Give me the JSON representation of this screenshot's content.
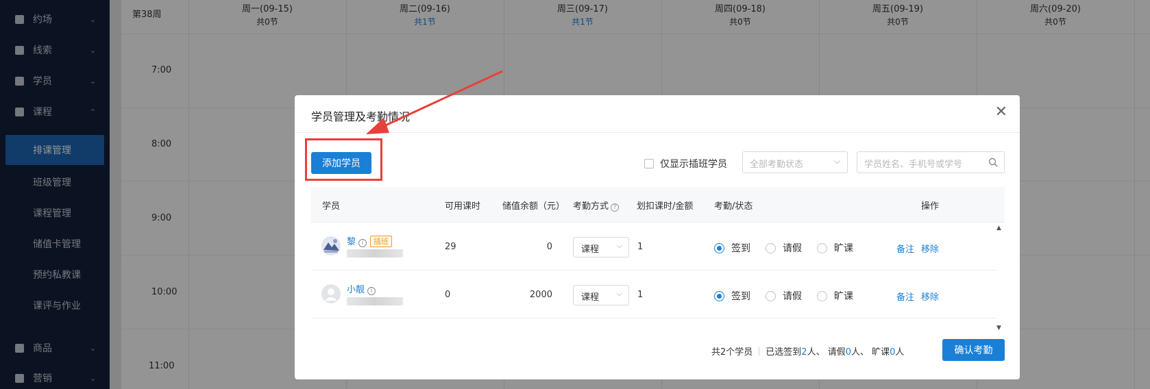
{
  "sidebar": {
    "items": [
      {
        "label": "约场",
        "icon": "calendar-check-icon",
        "expanded": false
      },
      {
        "label": "线索",
        "icon": "user-clue-icon",
        "expanded": false
      },
      {
        "label": "学员",
        "icon": "student-card-icon",
        "expanded": false
      },
      {
        "label": "课程",
        "icon": "course-book-icon",
        "expanded": true
      },
      {
        "label": "商品",
        "icon": "shopping-bag-icon",
        "expanded": false
      },
      {
        "label": "营销",
        "icon": "marketing-icon",
        "expanded": false
      }
    ],
    "course_sub": [
      "排课管理",
      "班级管理",
      "课程管理",
      "储值卡管理",
      "预约私教课",
      "课评与作业"
    ],
    "active_sub": "排课管理"
  },
  "calendar": {
    "week_label": "第38周",
    "days": [
      {
        "name": "周一(09-15)",
        "count": "共0节",
        "highlight": false
      },
      {
        "name": "周二(09-16)",
        "count": "共1节",
        "highlight": true
      },
      {
        "name": "周三(09-17)",
        "count": "共1节",
        "highlight": true
      },
      {
        "name": "周四(09-18)",
        "count": "共0节",
        "highlight": false
      },
      {
        "name": "周五(09-19)",
        "count": "共0节",
        "highlight": false
      },
      {
        "name": "周六(09-20)",
        "count": "共0节",
        "highlight": false
      }
    ],
    "times": [
      "7:00",
      "8:00",
      "9:00",
      "10:00",
      "11:00"
    ]
  },
  "modal": {
    "title": "学员管理及考勤情况",
    "add_student_label": "添加学员",
    "only_insert_label": "仅显示插班学员",
    "status_filter_placeholder": "全部考勤状态",
    "search_placeholder": "学员姓名、手机号或学号",
    "columns": {
      "student": "学员",
      "available_hours": "可用课时",
      "balance": "储值余额（元）",
      "attend_method": "考勤方式",
      "deduct": "划扣课时/金额",
      "status": "考勤/状态",
      "ops": "操作"
    },
    "rows": [
      {
        "name": "黎",
        "tag": "插班",
        "available_hours": "29",
        "balance": "0",
        "method": "课程",
        "deduct": "1",
        "status": "签到",
        "avatar": "photo-avatar"
      },
      {
        "name": "小靓",
        "tag": "",
        "available_hours": "0",
        "balance": "2000",
        "method": "课程",
        "deduct": "1",
        "status": "签到",
        "avatar": "default-avatar"
      }
    ],
    "status_options": [
      "签到",
      "请假",
      "旷课"
    ],
    "action_note": "备注",
    "action_remove": "移除",
    "footer": {
      "total": "共2个学员",
      "selected_prefix": "已选签到",
      "signed_count": "2",
      "unit1": "人、 请假",
      "leave_count": "0",
      "unit2": "人、 旷课",
      "absent_count": "0",
      "unit3": "人"
    },
    "confirm_label": "确认考勤"
  },
  "colors": {
    "primary": "#1a7fd6",
    "sidebar_bg": "#14203a",
    "highlight_red": "#e8403a",
    "tag_orange": "#f39a2b"
  }
}
